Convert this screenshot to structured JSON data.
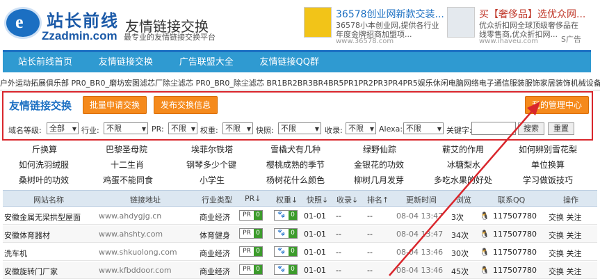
{
  "header": {
    "logo_glyph": "e",
    "logo_cn": "站长前线",
    "logo_en": "Zzadmin.com",
    "site_title": "友情链接交换",
    "site_subtitle": "最专业的友情链接交换平台"
  },
  "ads": [
    {
      "title": "36578创业网新款交装...",
      "desc": "36578小本创业网,提供各行业年度金牌招商加盟项...",
      "url": "www.36578.com"
    },
    {
      "title": "买【奢侈品】选优众网...",
      "desc": "优众折扣网全球顶级奢侈品在线零售商,优众折扣网...",
      "url": "www.ihaveu.com"
    }
  ],
  "ad_flag": "S广告",
  "nav": [
    "站长前线首页",
    "友情链接交换",
    "广告联盟大全",
    "友情链接QQ群"
  ],
  "ticker": "户外运动拓展俱乐部 PR0_BR0_磨坊宏图滤芯厂除尘滤芯 PR0_BR0_除尘滤芯 BR1BR2BR3BR4BR5PR1PR2PR3PR4PR5娱乐休闲电脑网络电子通信服装服饰家居装饰机械设备农林水产",
  "panel": {
    "title": "友情链接交换",
    "btn_batch": "批量申请交换",
    "btn_publish": "发布交换信息",
    "btn_manage": "我的管理中心",
    "filters": {
      "domain_level_label": "域名等级:",
      "domain_level_value": "全部",
      "industry_label": "行业:",
      "industry_value": "不限",
      "pr_label": "PR:",
      "pr_value": "不限",
      "weight_label": "权重:",
      "weight_value": "不限",
      "snapshot_label": "快照:",
      "snapshot_value": "不限",
      "index_label": "收录:",
      "index_value": "不限",
      "alexa_label": "Alexa:",
      "alexa_value": "不限",
      "keyword_label": "关键字:",
      "keyword_value": "",
      "search_btn": "搜索",
      "reset_btn": "重置"
    }
  },
  "categories": [
    [
      "斤换算",
      "巴黎圣母院",
      "埃菲尔铁塔",
      "雪橇犬有几种",
      "绿野仙踪",
      "蕲艾的作用",
      "如何辨别雪花梨"
    ],
    [
      "如何洗羽绒服",
      "十二生肖",
      "钢琴多少个键",
      "樱桃成熟的季节",
      "金银花的功效",
      "冰糖梨水",
      "单位换算"
    ],
    [
      "桑树叶的功效",
      "鸡蛋不能同食",
      "小学生",
      "杨树花什么颜色",
      "柳树几月发芽",
      "多吃水果的好处",
      "学习做饭技巧"
    ]
  ],
  "table": {
    "headers": [
      "网站名称",
      "链接地址",
      "行业类型",
      "PR↓",
      "权重↓",
      "快照↓",
      "收录↓",
      "排名↑",
      "更新时间",
      "浏览",
      "联系QQ",
      "操作"
    ],
    "rows": [
      {
        "name": "安徽金属无梁拱型屋面",
        "url": "www.ahdygjg.cn",
        "industry": "商业经济",
        "pr": "PR",
        "pr_val": "0",
        "wt_val": "0",
        "snapshot": "01-01",
        "index": "--",
        "rank": "--",
        "time": "08-04 13:47",
        "views": "3次",
        "qq": "117507780",
        "ops": "交换 关注"
      },
      {
        "name": "安徽体育器材",
        "url": "www.ahshty.com",
        "industry": "体育健身",
        "pr": "PR",
        "pr_val": "0",
        "wt_val": "0",
        "snapshot": "01-01",
        "index": "--",
        "rank": "--",
        "time": "08-04 13:47",
        "views": "34次",
        "qq": "117507780",
        "ops": "交换 关注"
      },
      {
        "name": "洗车机",
        "url": "www.shkuolong.com",
        "industry": "商业经济",
        "pr": "PR",
        "pr_val": "0",
        "wt_val": "0",
        "snapshot": "01-01",
        "index": "--",
        "rank": "--",
        "time": "08-04 13:46",
        "views": "30次",
        "qq": "117507780",
        "ops": "交换 关注"
      },
      {
        "name": "安徽旋转门厂家",
        "url": "www.kfbddoor.com",
        "industry": "商业经济",
        "pr": "PR",
        "pr_val": "0",
        "wt_val": "0",
        "snapshot": "01-01",
        "index": "--",
        "rank": "--",
        "time": "08-04 13:46",
        "views": "45次",
        "qq": "117507780",
        "ops": "交换 关注"
      }
    ]
  },
  "colors": {
    "accent": "#2f9ad1",
    "orange": "#f58a1c",
    "highlight": "#d9262c"
  }
}
